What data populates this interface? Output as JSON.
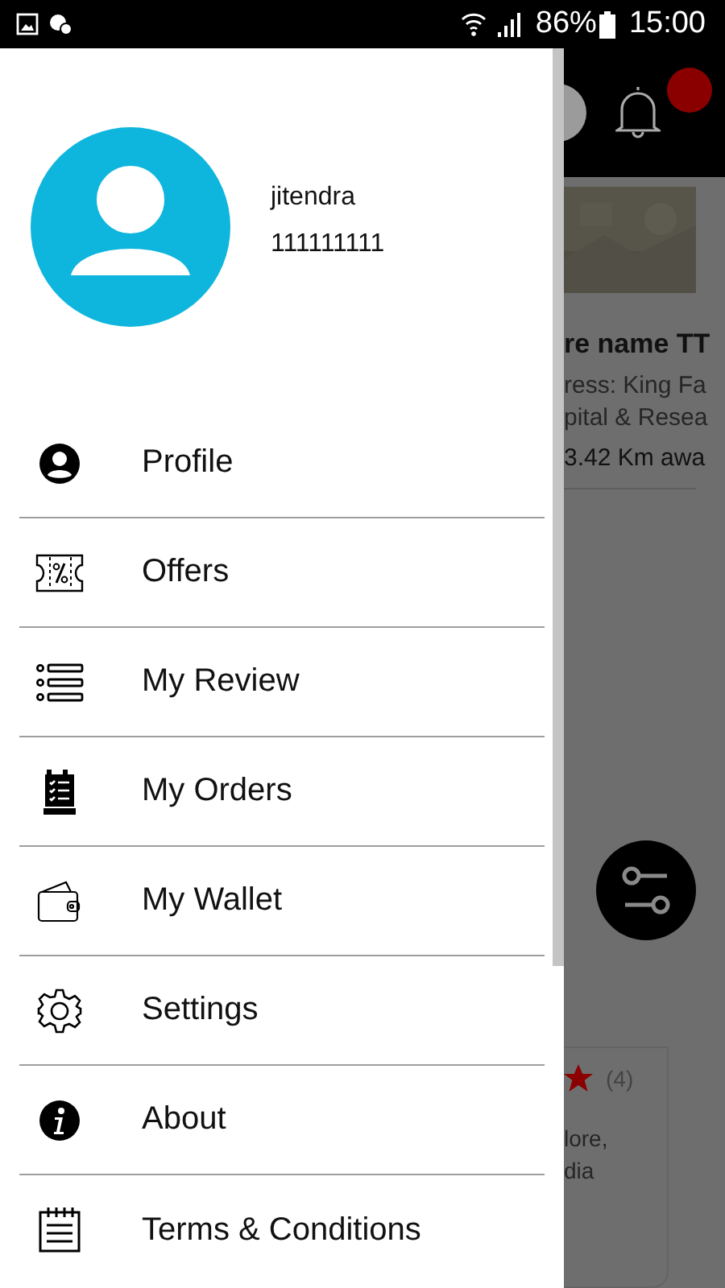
{
  "status_bar": {
    "battery": "86%",
    "time": "15:00"
  },
  "user": {
    "name": "jitendra",
    "phone": "111111111"
  },
  "menu": [
    {
      "label": "Profile",
      "kind": "profile"
    },
    {
      "label": "Offers",
      "kind": "offers"
    },
    {
      "label": "My Review",
      "kind": "review"
    },
    {
      "label": "My Orders",
      "kind": "orders"
    },
    {
      "label": "My Wallet",
      "kind": "wallet"
    },
    {
      "label": "Settings",
      "kind": "settings"
    },
    {
      "label": "About",
      "kind": "about"
    },
    {
      "label": "Terms & Conditions",
      "kind": "terms"
    }
  ],
  "background": {
    "store_name": "re name TT",
    "address_lines": [
      "ress: King Fa",
      "pital & Resea"
    ],
    "distance": "3.42 Km awa",
    "rating_count": "(4)",
    "card_lines": [
      "lore,",
      "dia"
    ]
  }
}
